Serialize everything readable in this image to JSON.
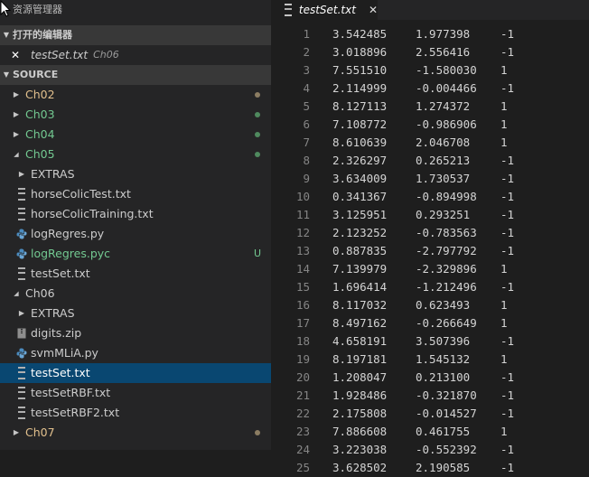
{
  "explorer": {
    "title": "资源管理器",
    "open_editors_label": "打开的编辑器",
    "open_file": {
      "name": "testSet.txt",
      "folder": "Ch06"
    },
    "source_label": "SOURCE"
  },
  "tree": [
    {
      "label": "Ch02",
      "kind": "folder",
      "expanded": false,
      "indent": 1,
      "color": "#e2c08d",
      "status": "modified"
    },
    {
      "label": "Ch03",
      "kind": "folder",
      "expanded": false,
      "indent": 1,
      "color": "#73c991",
      "status": "untracked"
    },
    {
      "label": "Ch04",
      "kind": "folder",
      "expanded": false,
      "indent": 1,
      "color": "#73c991",
      "status": "untracked"
    },
    {
      "label": "Ch05",
      "kind": "folder",
      "expanded": true,
      "indent": 1,
      "color": "#73c991",
      "status": "untracked"
    },
    {
      "label": "EXTRAS",
      "kind": "folder",
      "expanded": false,
      "indent": 2,
      "color": "#cccccc"
    },
    {
      "label": "horseColicTest.txt",
      "kind": "txt",
      "indent": 2,
      "color": "#cccccc"
    },
    {
      "label": "horseColicTraining.txt",
      "kind": "txt",
      "indent": 2,
      "color": "#cccccc"
    },
    {
      "label": "logRegres.py",
      "kind": "py",
      "indent": 2,
      "color": "#cccccc"
    },
    {
      "label": "logRegres.pyc",
      "kind": "py",
      "indent": 2,
      "color": "#73c991",
      "badge": "U"
    },
    {
      "label": "testSet.txt",
      "kind": "txt",
      "indent": 2,
      "color": "#cccccc"
    },
    {
      "label": "Ch06",
      "kind": "folder",
      "expanded": true,
      "indent": 1,
      "color": "#cccccc"
    },
    {
      "label": "EXTRAS",
      "kind": "folder",
      "expanded": false,
      "indent": 2,
      "color": "#cccccc"
    },
    {
      "label": "digits.zip",
      "kind": "zip",
      "indent": 2,
      "color": "#cccccc"
    },
    {
      "label": "svmMLiA.py",
      "kind": "py",
      "indent": 2,
      "color": "#cccccc"
    },
    {
      "label": "testSet.txt",
      "kind": "txt",
      "indent": 2,
      "color": "#ffffff",
      "selected": true
    },
    {
      "label": "testSetRBF.txt",
      "kind": "txt",
      "indent": 2,
      "color": "#cccccc"
    },
    {
      "label": "testSetRBF2.txt",
      "kind": "txt",
      "indent": 2,
      "color": "#cccccc"
    },
    {
      "label": "Ch07",
      "kind": "folder",
      "expanded": false,
      "indent": 1,
      "color": "#e2c08d",
      "status": "modified"
    }
  ],
  "colors": {
    "modified_dot": "#8c7d62",
    "untracked_dot": "#4f8a5e",
    "python_icon": "#4b8bbe",
    "selection": "#094771"
  },
  "editor": {
    "tab_title": "testSet.txt",
    "lines": [
      [
        "1",
        "3.542485",
        "1.977398",
        "-1"
      ],
      [
        "2",
        "3.018896",
        "2.556416",
        "-1"
      ],
      [
        "3",
        "7.551510",
        "-1.580030",
        "1"
      ],
      [
        "4",
        "2.114999",
        "-0.004466",
        "-1"
      ],
      [
        "5",
        "8.127113",
        "1.274372",
        "1"
      ],
      [
        "6",
        "7.108772",
        "-0.986906",
        "1"
      ],
      [
        "7",
        "8.610639",
        "2.046708",
        "1"
      ],
      [
        "8",
        "2.326297",
        "0.265213",
        "-1"
      ],
      [
        "9",
        "3.634009",
        "1.730537",
        "-1"
      ],
      [
        "10",
        "0.341367",
        "-0.894998",
        "-1"
      ],
      [
        "11",
        "3.125951",
        "0.293251",
        "-1"
      ],
      [
        "12",
        "2.123252",
        "-0.783563",
        "-1"
      ],
      [
        "13",
        "0.887835",
        "-2.797792",
        "-1"
      ],
      [
        "14",
        "7.139979",
        "-2.329896",
        "1"
      ],
      [
        "15",
        "1.696414",
        "-1.212496",
        "-1"
      ],
      [
        "16",
        "8.117032",
        "0.623493",
        "1"
      ],
      [
        "17",
        "8.497162",
        "-0.266649",
        "1"
      ],
      [
        "18",
        "4.658191",
        "3.507396",
        "-1"
      ],
      [
        "19",
        "8.197181",
        "1.545132",
        "1"
      ],
      [
        "20",
        "1.208047",
        "0.213100",
        "-1"
      ],
      [
        "21",
        "1.928486",
        "-0.321870",
        "-1"
      ],
      [
        "22",
        "2.175808",
        "-0.014527",
        "-1"
      ],
      [
        "23",
        "7.886608",
        "0.461755",
        "1"
      ],
      [
        "24",
        "3.223038",
        "-0.552392",
        "-1"
      ],
      [
        "25",
        "3.628502",
        "2.190585",
        "-1"
      ]
    ]
  }
}
